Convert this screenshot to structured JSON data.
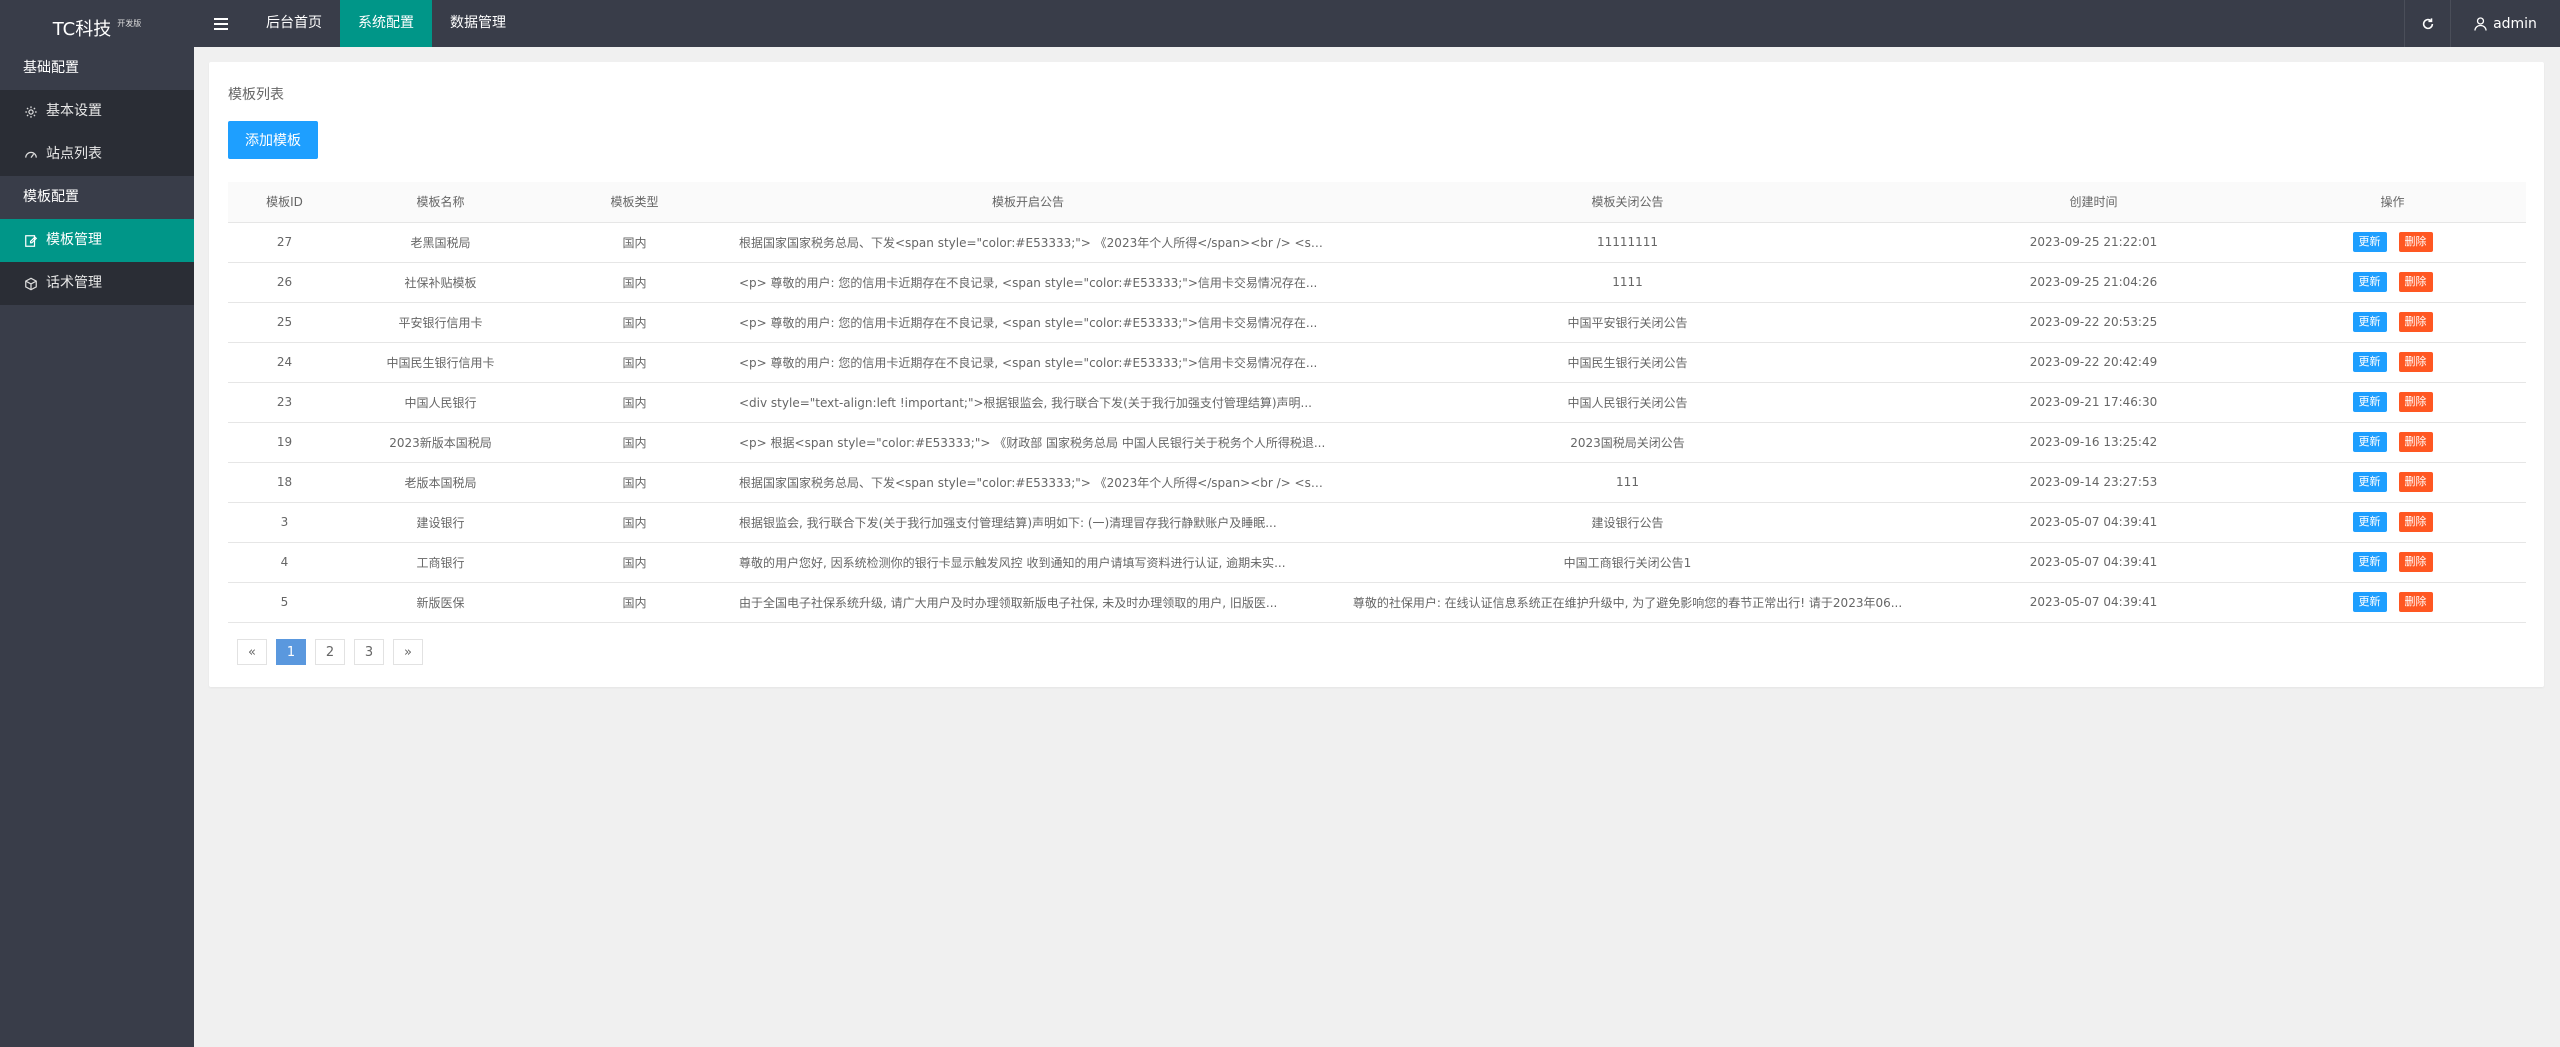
{
  "app": {
    "title": "TC科技",
    "badge": "开发版"
  },
  "sidebar": {
    "group1": "基础配置",
    "items1": [
      {
        "label": "基本设置",
        "icon": "gear-icon"
      },
      {
        "label": "站点列表",
        "icon": "dashboard-icon"
      }
    ],
    "group2": "模板配置",
    "items2": [
      {
        "label": "模板管理",
        "icon": "edit-icon"
      },
      {
        "label": "话术管理",
        "icon": "box-icon"
      }
    ]
  },
  "header": {
    "tabs": [
      "后台首页",
      "系统配置",
      "数据管理"
    ],
    "user": "admin"
  },
  "main": {
    "title": "模板列表",
    "add_button": "添加模板",
    "columns": [
      "模板ID",
      "模板名称",
      "模板类型",
      "模板开启公告",
      "模板关闭公告",
      "创建时间",
      "操作"
    ],
    "edit_label": "更新",
    "delete_label": "删除",
    "rows": [
      {
        "id": "27",
        "name": "老黑国税局",
        "type": "国内",
        "open": "根据国家国家税务总局、下发<span style=\"color:#E53333;\"> 《2023年个人所得</span><br /> <spa...",
        "close": "11111111",
        "time": "2023-09-25 21:22:01"
      },
      {
        "id": "26",
        "name": "社保补贴模板",
        "type": "国内",
        "open": "<p> 尊敬的用户: 您的信用卡近期存在不良记录, <span style=\"color:#E53333;\">信用卡交易情况存在...",
        "close": "1111",
        "time": "2023-09-25 21:04:26"
      },
      {
        "id": "25",
        "name": "平安银行信用卡",
        "type": "国内",
        "open": "<p> 尊敬的用户: 您的信用卡近期存在不良记录, <span style=\"color:#E53333;\">信用卡交易情况存在...",
        "close": "中国平安银行关闭公告",
        "time": "2023-09-22 20:53:25"
      },
      {
        "id": "24",
        "name": "中国民生银行信用卡",
        "type": "国内",
        "open": "<p> 尊敬的用户: 您的信用卡近期存在不良记录, <span style=\"color:#E53333;\">信用卡交易情况存在...",
        "close": "中国民生银行关闭公告",
        "time": "2023-09-22 20:42:49"
      },
      {
        "id": "23",
        "name": "中国人民银行",
        "type": "国内",
        "open": "<div style=\"text-align:left !important;\">根据银监会, 我行联合下发(关于我行加强支付管理结算)声明...",
        "close": "中国人民银行关闭公告",
        "time": "2023-09-21 17:46:30"
      },
      {
        "id": "19",
        "name": "2023新版本国税局",
        "type": "国内",
        "open": "<p> 根据<span style=\"color:#E53333;\"> 《财政部 国家税务总局 中国人民银行关于税务个人所得税退...",
        "close": "2023国税局关闭公告",
        "time": "2023-09-16 13:25:42"
      },
      {
        "id": "18",
        "name": "老版本国税局",
        "type": "国内",
        "open": "根据国家国家税务总局、下发<span style=\"color:#E53333;\"> 《2023年个人所得</span><br /> <spa...",
        "close": "111",
        "time": "2023-09-14 23:27:53"
      },
      {
        "id": "3",
        "name": "建设银行",
        "type": "国内",
        "open": "根据银监会, 我行联合下发(关于我行加强支付管理结算)声明如下: (一)清理冒存我行静默账户及睡眠...",
        "close": "建设银行公告",
        "time": "2023-05-07 04:39:41"
      },
      {
        "id": "4",
        "name": "工商银行",
        "type": "国内",
        "open": "尊敬的用户您好, 因系统检测你的银行卡显示触发风控 收到通知的用户请填写资料进行认证, 逾期未实...",
        "close": "中国工商银行关闭公告1",
        "time": "2023-05-07 04:39:41"
      },
      {
        "id": "5",
        "name": "新版医保",
        "type": "国内",
        "open": "由于全国电子社保系统升级, 请广大用户及时办理领取新版电子社保, 未及时办理领取的用户, 旧版医...",
        "close": "尊敬的社保用户: 在线认证信息系统正在维护升级中, 为了避免影响您的春节正常出行! 请于2023年06...",
        "time": "2023-05-07 04:39:41"
      }
    ]
  },
  "pagination": {
    "prev": "«",
    "pages": [
      "1",
      "2",
      "3"
    ],
    "next": "»",
    "current": "1"
  },
  "colors": {
    "sidebar": "#393d49",
    "accent": "#009688",
    "primary": "#1e9fff",
    "danger": "#ff5722"
  }
}
